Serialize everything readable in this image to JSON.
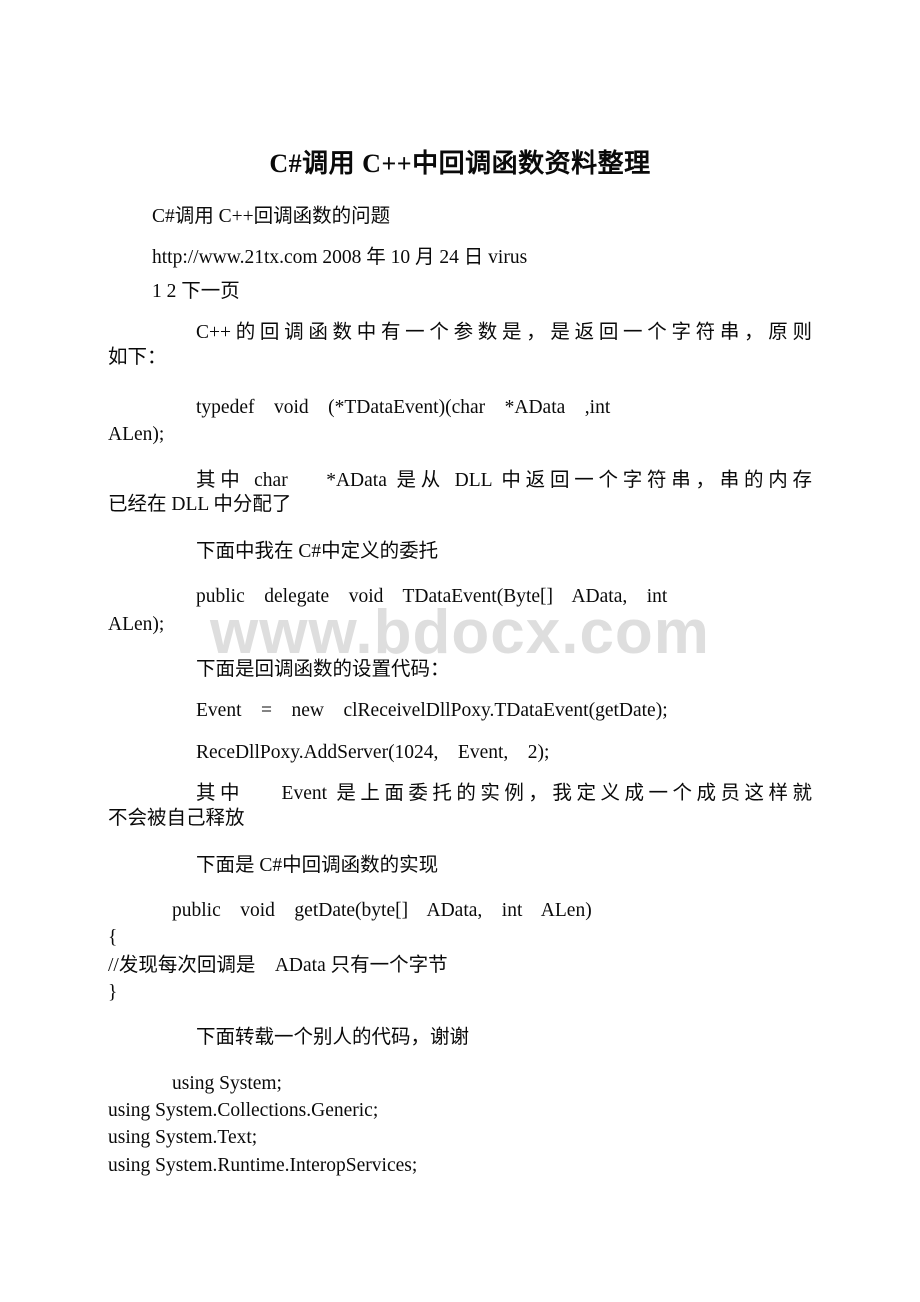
{
  "document": {
    "title": "C#调用 C++中回调函数资料整理",
    "watermark": "www.bdocx.com"
  },
  "body": {
    "subtitle": "C#调用 C++回调函数的问题",
    "source_line": "http://www.21tx.com 2008 年 10 月 24 日 virus",
    "pager": "1 2 下一页",
    "p_intro_a": "C++的回调函数中有一个参数是，是返回一个字符串，原则",
    "p_intro_b": "如下：",
    "code_typedef_a": "typedef    void    (*TDataEvent)(char    *AData    ,int",
    "code_typedef_b": "ALen);",
    "p_char_a": "其中 char    *AData 是从 DLL 中返回一个字符串，串的内存",
    "p_char_b": "已经在 DLL 中分配了",
    "p_delegate_head": "下面中我在 C#中定义的委托",
    "code_delegate_a": "public    delegate    void    TDataEvent(Byte[]    AData,    int",
    "code_delegate_b": "ALen);",
    "p_setup_head": "下面是回调函数的设置代码：",
    "code_event_new": "Event    =    new    clReceivelDllPoxy.TDataEvent(getDate);",
    "code_addserver": "ReceDllPoxy.AddServer(1024,    Event,    2);",
    "p_member_a": "其中    Event 是上面委托的实例，我定义成一个成员这样就",
    "p_member_b": "不会被自己释放",
    "p_impl_head": "下面是 C#中回调函数的实现",
    "code_getdate_sig": "public    void    getDate(byte[]    AData,    int    ALen)",
    "code_brace_open": "{",
    "code_comment": "//发现每次回调是    AData 只有一个字节",
    "code_brace_close": "}",
    "p_repost_head": "下面转载一个别人的代码，谢谢",
    "code_using_system": "using System;",
    "code_using_collections": "using System.Collections.Generic;",
    "code_using_text": "using System.Text;",
    "code_using_interop": "using System.Runtime.InteropServices;"
  },
  "colors": {
    "page_background": "#ffffff",
    "text": "#0a0a0a",
    "watermark": "#dedede"
  }
}
